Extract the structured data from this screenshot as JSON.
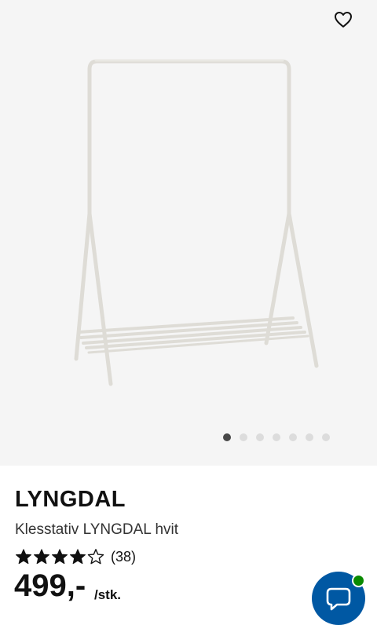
{
  "product": {
    "name": "LYNGDAL",
    "description": "Klesstativ LYNGDAL hvit",
    "rating": 4,
    "rating_max": 5,
    "review_count": "(38)",
    "price": "499,-",
    "price_unit": "/stk."
  },
  "gallery": {
    "image_count": 7,
    "active_index": 0
  },
  "icons": {
    "favorite": "heart-outline-icon",
    "chat": "chat-bubble-icon",
    "star_full": "star-filled-icon",
    "star_empty": "star-outline-icon"
  },
  "colors": {
    "hero_background": "#f5f5f5",
    "chat_button": "#0058a3",
    "online_status": "#0a8a00",
    "dot_active": "#484848",
    "dot_inactive": "#dcdcdc"
  }
}
